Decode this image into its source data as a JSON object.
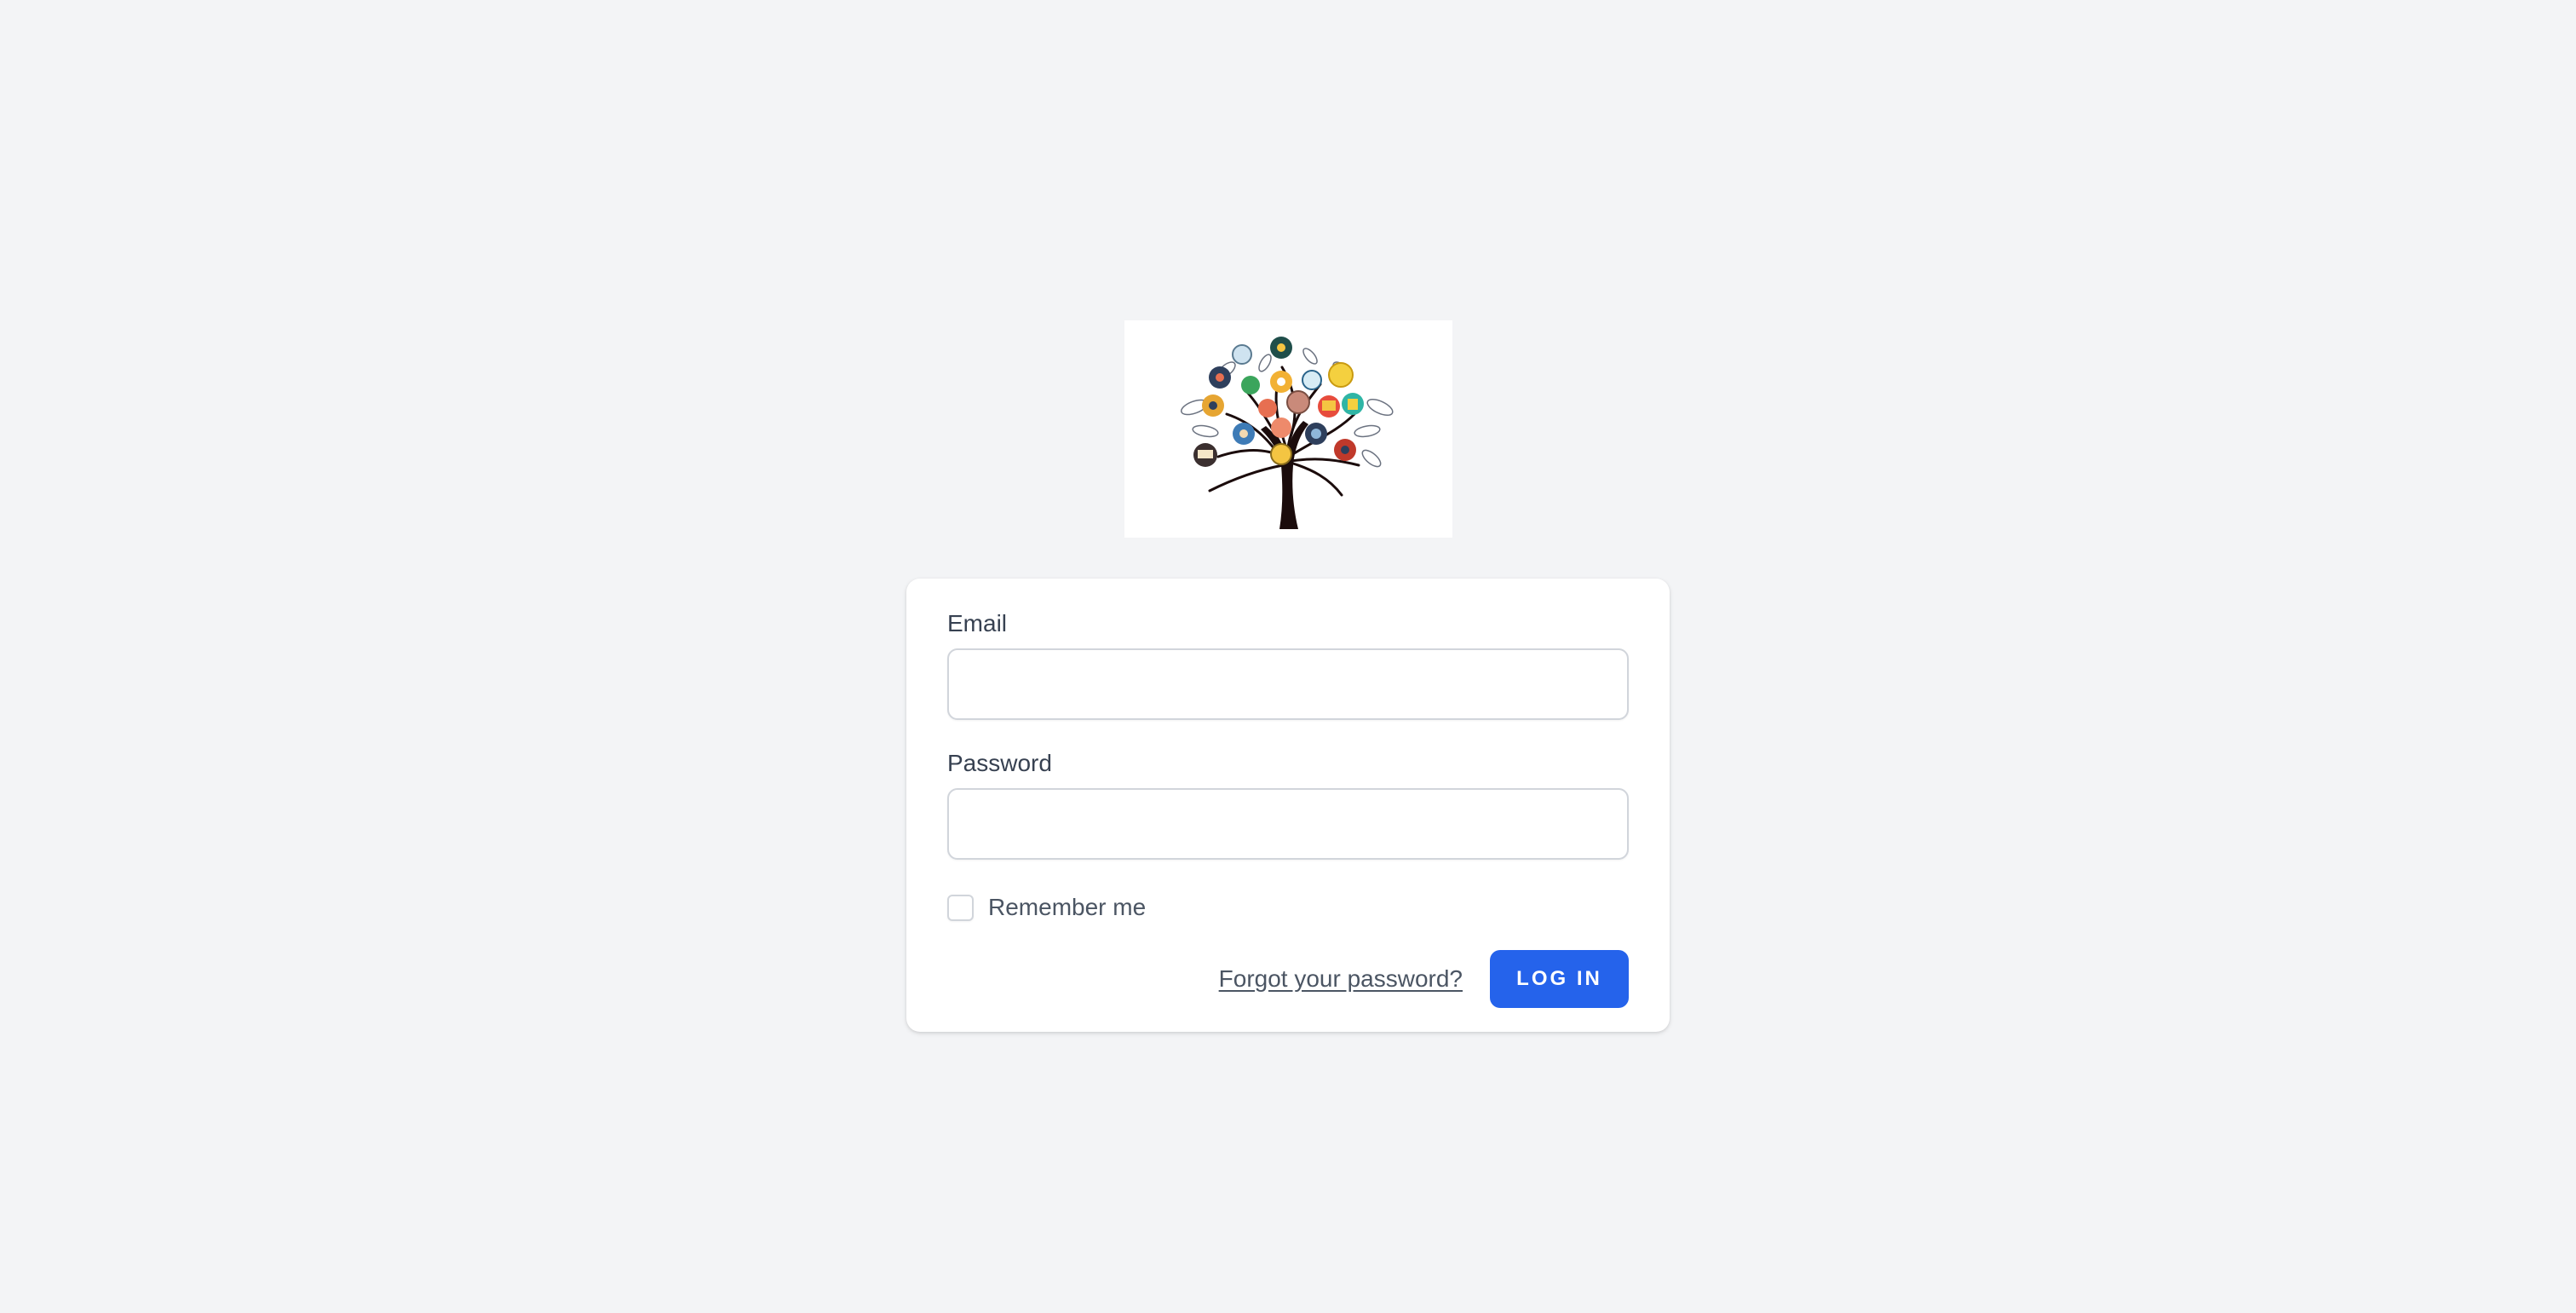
{
  "login_form": {
    "email_label": "Email",
    "email_value": "",
    "password_label": "Password",
    "password_value": "",
    "remember_label": "Remember me",
    "remember_checked": false,
    "forgot_link": "Forgot your password?",
    "login_button": "LOG IN"
  },
  "logo": {
    "icon": "tree-of-icons-logo"
  },
  "colors": {
    "page_background": "#f3f4f6",
    "card_background": "#ffffff",
    "button_primary": "#2563eb",
    "input_border": "#d1d5db",
    "label_text": "#374151",
    "secondary_text": "#4b5563"
  }
}
